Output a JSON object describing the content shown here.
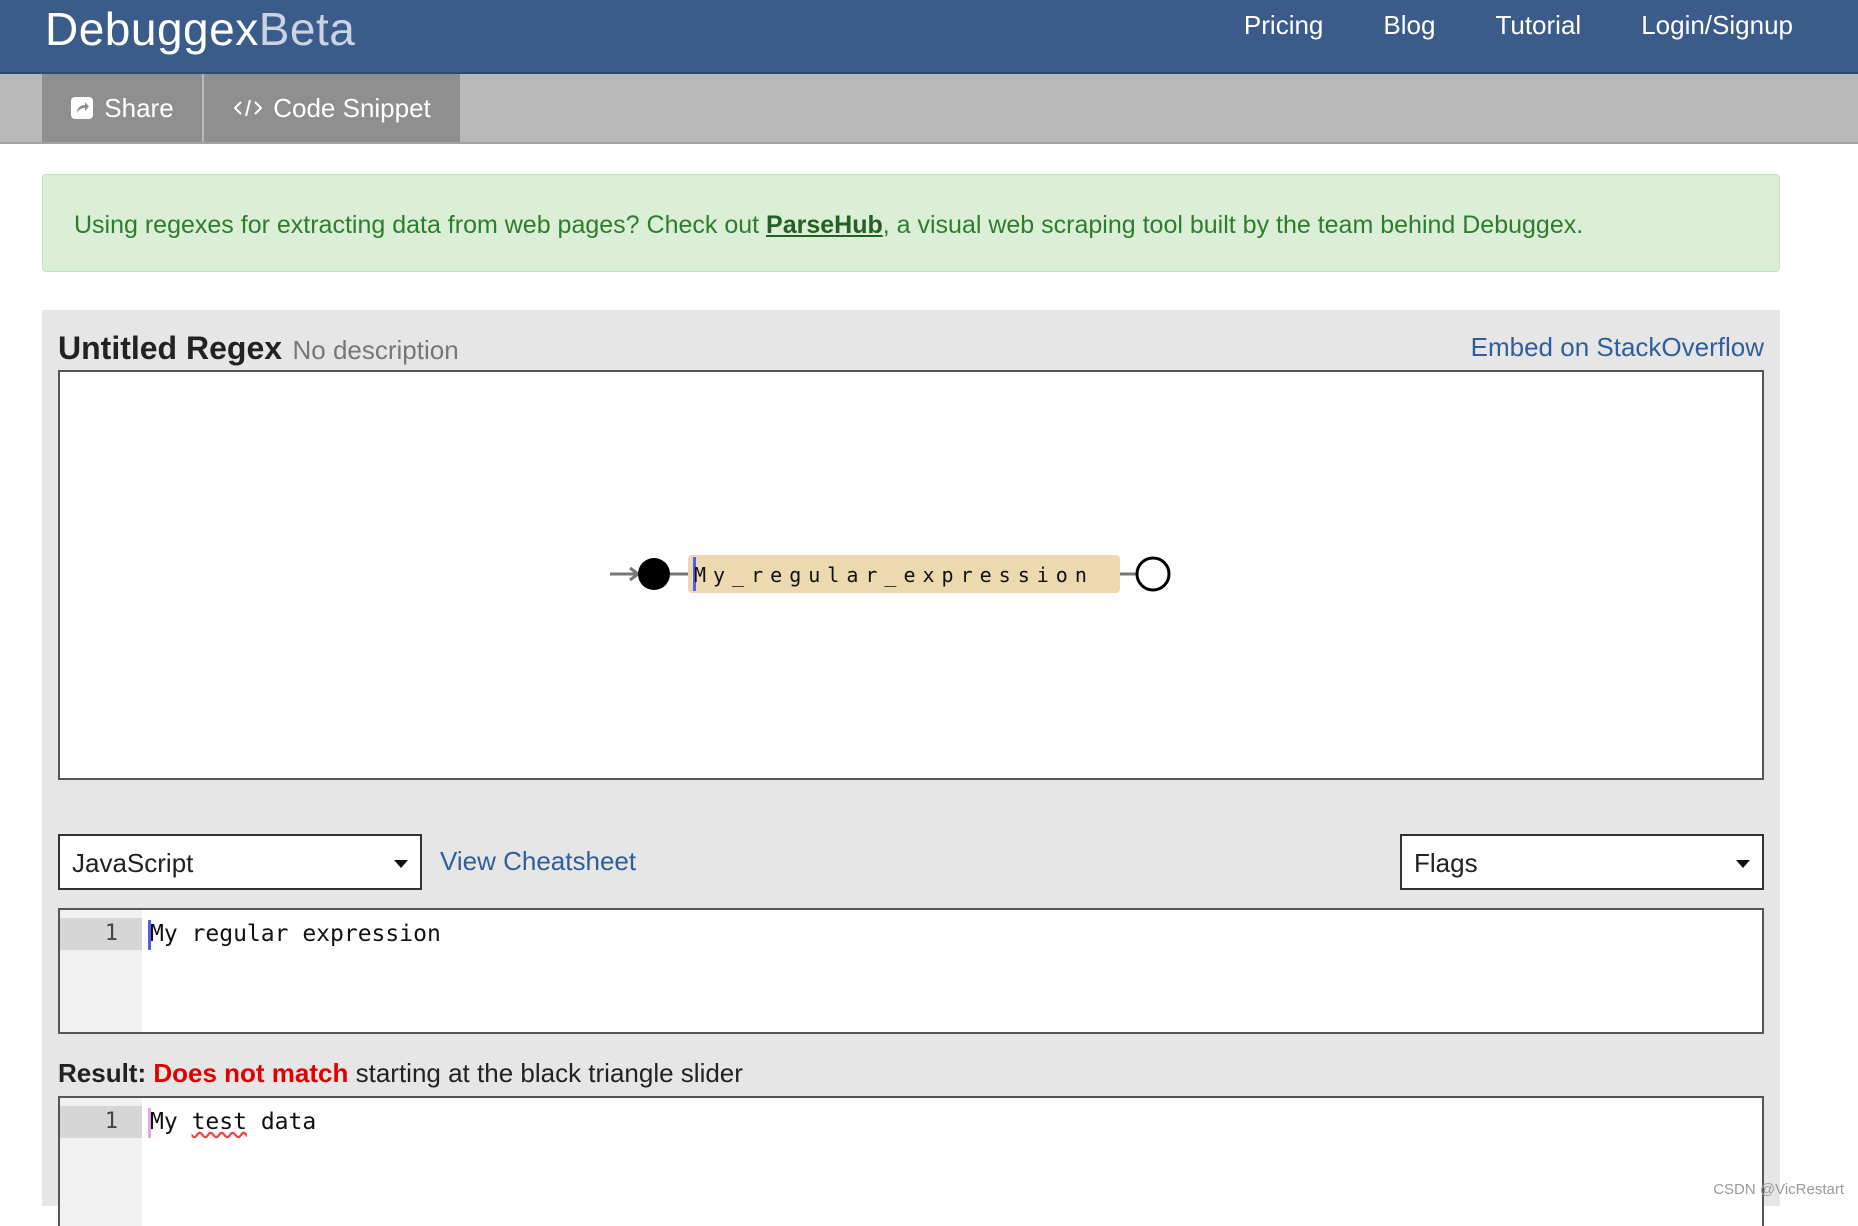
{
  "brand": {
    "main": "Debuggex",
    "suffix": "Beta"
  },
  "nav": {
    "items": [
      "Pricing",
      "Blog",
      "Tutorial",
      "Login/Signup"
    ]
  },
  "toolbar": {
    "share_label": "Share",
    "snippet_label": "Code Snippet"
  },
  "alert": {
    "text_before": "Using regexes for extracting data from web pages? Check out ",
    "link_text": "ParseHub",
    "text_after": ", a visual web scraping tool built by the team behind Debuggex."
  },
  "regex": {
    "title": "Untitled Regex",
    "description": "No description",
    "embed_label": "Embed on StackOverflow",
    "railroad_text": "My_regular_expression",
    "language": "JavaScript",
    "cheatsheet_label": "View Cheatsheet",
    "flags_label": "Flags",
    "pattern": "My regular expression",
    "line_number": "1"
  },
  "result": {
    "label": "Result:",
    "status": "Does not match",
    "detail": " starting at the black triangle slider",
    "test_data": "My test data",
    "line_number": "1"
  },
  "watermark": "CSDN @VicRestart",
  "colors": {
    "navbar": "#3b5b8a",
    "toolbar_button": "#8f8f8f",
    "alert_bg": "#dbeed6",
    "alert_text": "#2e7d2e",
    "link": "#2f5f9a",
    "railroad_box": "#ecd9b0",
    "no_match": "#e00000"
  },
  "icons": [
    "share-icon",
    "code-icon",
    "caret-down-icon"
  ]
}
